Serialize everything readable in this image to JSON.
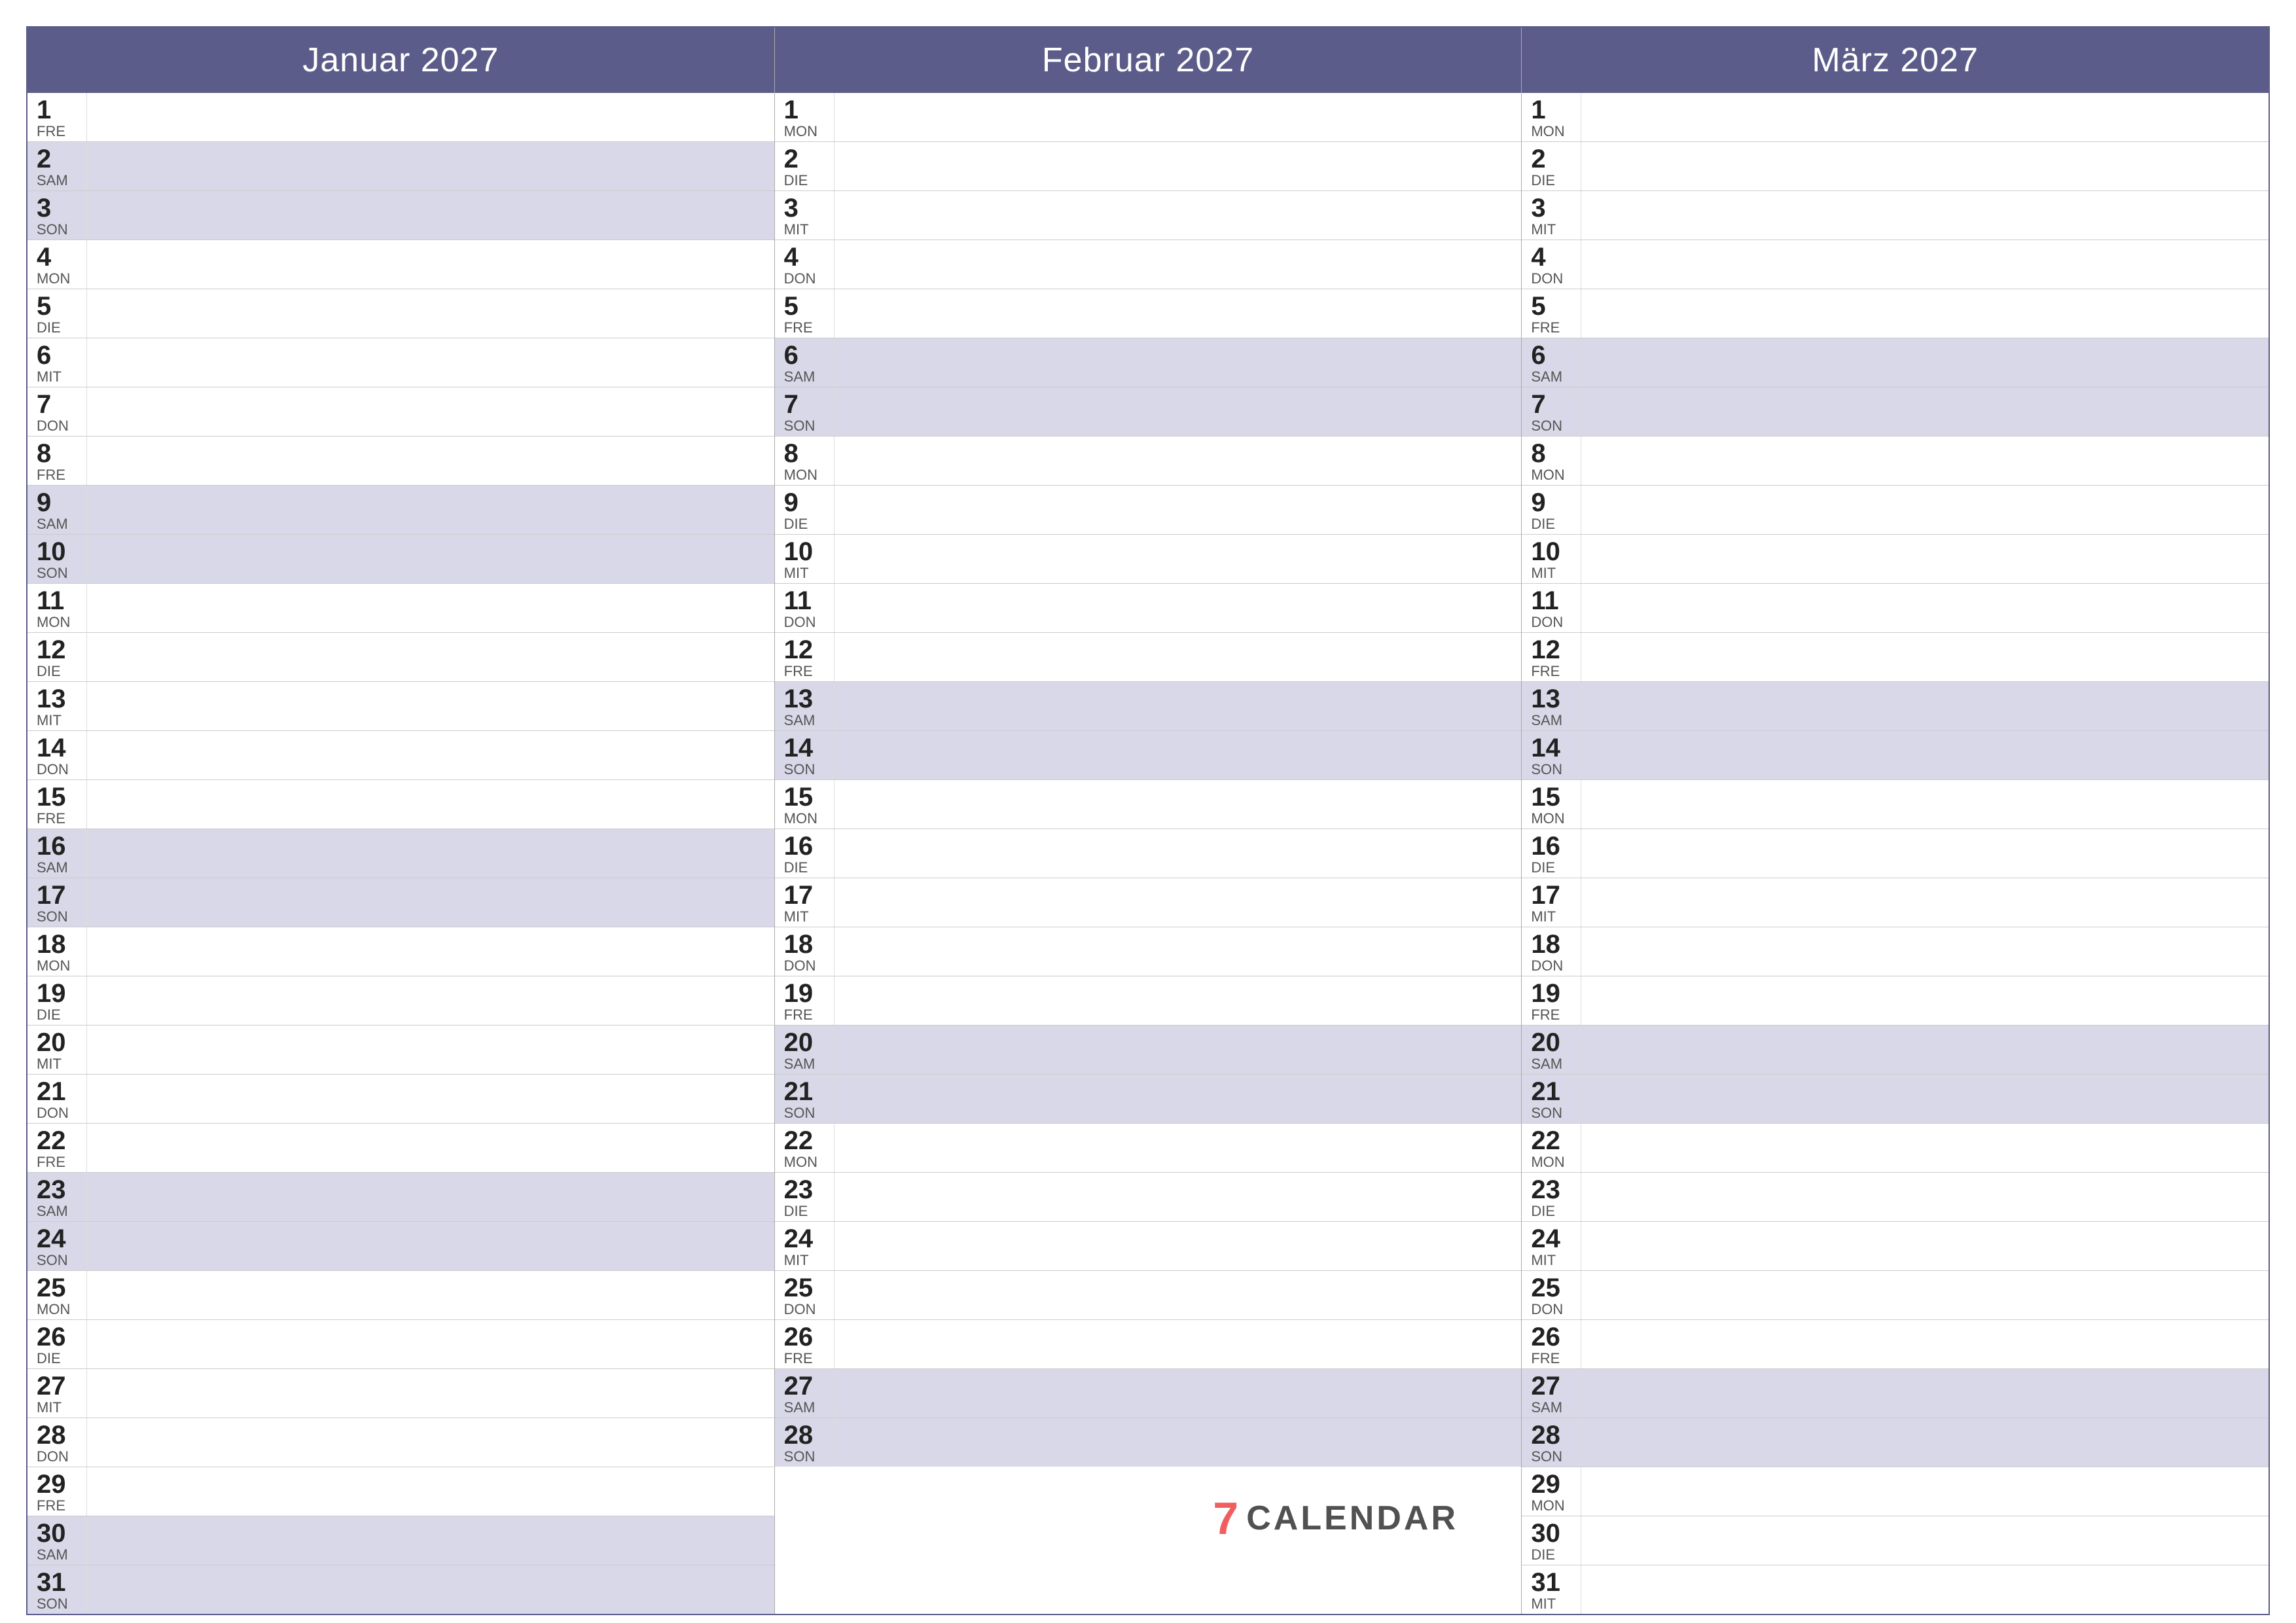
{
  "months": [
    {
      "title": "Januar 2027",
      "days": [
        {
          "num": "1",
          "abbr": "FRE",
          "weekend": false
        },
        {
          "num": "2",
          "abbr": "SAM",
          "weekend": true
        },
        {
          "num": "3",
          "abbr": "SON",
          "weekend": true
        },
        {
          "num": "4",
          "abbr": "MON",
          "weekend": false
        },
        {
          "num": "5",
          "abbr": "DIE",
          "weekend": false
        },
        {
          "num": "6",
          "abbr": "MIT",
          "weekend": false
        },
        {
          "num": "7",
          "abbr": "DON",
          "weekend": false
        },
        {
          "num": "8",
          "abbr": "FRE",
          "weekend": false
        },
        {
          "num": "9",
          "abbr": "SAM",
          "weekend": true
        },
        {
          "num": "10",
          "abbr": "SON",
          "weekend": true
        },
        {
          "num": "11",
          "abbr": "MON",
          "weekend": false
        },
        {
          "num": "12",
          "abbr": "DIE",
          "weekend": false
        },
        {
          "num": "13",
          "abbr": "MIT",
          "weekend": false
        },
        {
          "num": "14",
          "abbr": "DON",
          "weekend": false
        },
        {
          "num": "15",
          "abbr": "FRE",
          "weekend": false
        },
        {
          "num": "16",
          "abbr": "SAM",
          "weekend": true
        },
        {
          "num": "17",
          "abbr": "SON",
          "weekend": true
        },
        {
          "num": "18",
          "abbr": "MON",
          "weekend": false
        },
        {
          "num": "19",
          "abbr": "DIE",
          "weekend": false
        },
        {
          "num": "20",
          "abbr": "MIT",
          "weekend": false
        },
        {
          "num": "21",
          "abbr": "DON",
          "weekend": false
        },
        {
          "num": "22",
          "abbr": "FRE",
          "weekend": false
        },
        {
          "num": "23",
          "abbr": "SAM",
          "weekend": true
        },
        {
          "num": "24",
          "abbr": "SON",
          "weekend": true
        },
        {
          "num": "25",
          "abbr": "MON",
          "weekend": false
        },
        {
          "num": "26",
          "abbr": "DIE",
          "weekend": false
        },
        {
          "num": "27",
          "abbr": "MIT",
          "weekend": false
        },
        {
          "num": "28",
          "abbr": "DON",
          "weekend": false
        },
        {
          "num": "29",
          "abbr": "FRE",
          "weekend": false
        },
        {
          "num": "30",
          "abbr": "SAM",
          "weekend": true
        },
        {
          "num": "31",
          "abbr": "SON",
          "weekend": true
        }
      ]
    },
    {
      "title": "Februar 2027",
      "days": [
        {
          "num": "1",
          "abbr": "MON",
          "weekend": false
        },
        {
          "num": "2",
          "abbr": "DIE",
          "weekend": false
        },
        {
          "num": "3",
          "abbr": "MIT",
          "weekend": false
        },
        {
          "num": "4",
          "abbr": "DON",
          "weekend": false
        },
        {
          "num": "5",
          "abbr": "FRE",
          "weekend": false
        },
        {
          "num": "6",
          "abbr": "SAM",
          "weekend": true
        },
        {
          "num": "7",
          "abbr": "SON",
          "weekend": true
        },
        {
          "num": "8",
          "abbr": "MON",
          "weekend": false
        },
        {
          "num": "9",
          "abbr": "DIE",
          "weekend": false
        },
        {
          "num": "10",
          "abbr": "MIT",
          "weekend": false
        },
        {
          "num": "11",
          "abbr": "DON",
          "weekend": false
        },
        {
          "num": "12",
          "abbr": "FRE",
          "weekend": false
        },
        {
          "num": "13",
          "abbr": "SAM",
          "weekend": true
        },
        {
          "num": "14",
          "abbr": "SON",
          "weekend": true
        },
        {
          "num": "15",
          "abbr": "MON",
          "weekend": false
        },
        {
          "num": "16",
          "abbr": "DIE",
          "weekend": false
        },
        {
          "num": "17",
          "abbr": "MIT",
          "weekend": false
        },
        {
          "num": "18",
          "abbr": "DON",
          "weekend": false
        },
        {
          "num": "19",
          "abbr": "FRE",
          "weekend": false
        },
        {
          "num": "20",
          "abbr": "SAM",
          "weekend": true
        },
        {
          "num": "21",
          "abbr": "SON",
          "weekend": true
        },
        {
          "num": "22",
          "abbr": "MON",
          "weekend": false
        },
        {
          "num": "23",
          "abbr": "DIE",
          "weekend": false
        },
        {
          "num": "24",
          "abbr": "MIT",
          "weekend": false
        },
        {
          "num": "25",
          "abbr": "DON",
          "weekend": false
        },
        {
          "num": "26",
          "abbr": "FRE",
          "weekend": false
        },
        {
          "num": "27",
          "abbr": "SAM",
          "weekend": true
        },
        {
          "num": "28",
          "abbr": "SON",
          "weekend": true
        }
      ]
    },
    {
      "title": "März 2027",
      "days": [
        {
          "num": "1",
          "abbr": "MON",
          "weekend": false
        },
        {
          "num": "2",
          "abbr": "DIE",
          "weekend": false
        },
        {
          "num": "3",
          "abbr": "MIT",
          "weekend": false
        },
        {
          "num": "4",
          "abbr": "DON",
          "weekend": false
        },
        {
          "num": "5",
          "abbr": "FRE",
          "weekend": false
        },
        {
          "num": "6",
          "abbr": "SAM",
          "weekend": true
        },
        {
          "num": "7",
          "abbr": "SON",
          "weekend": true
        },
        {
          "num": "8",
          "abbr": "MON",
          "weekend": false
        },
        {
          "num": "9",
          "abbr": "DIE",
          "weekend": false
        },
        {
          "num": "10",
          "abbr": "MIT",
          "weekend": false
        },
        {
          "num": "11",
          "abbr": "DON",
          "weekend": false
        },
        {
          "num": "12",
          "abbr": "FRE",
          "weekend": false
        },
        {
          "num": "13",
          "abbr": "SAM",
          "weekend": true
        },
        {
          "num": "14",
          "abbr": "SON",
          "weekend": true
        },
        {
          "num": "15",
          "abbr": "MON",
          "weekend": false
        },
        {
          "num": "16",
          "abbr": "DIE",
          "weekend": false
        },
        {
          "num": "17",
          "abbr": "MIT",
          "weekend": false
        },
        {
          "num": "18",
          "abbr": "DON",
          "weekend": false
        },
        {
          "num": "19",
          "abbr": "FRE",
          "weekend": false
        },
        {
          "num": "20",
          "abbr": "SAM",
          "weekend": true
        },
        {
          "num": "21",
          "abbr": "SON",
          "weekend": true
        },
        {
          "num": "22",
          "abbr": "MON",
          "weekend": false
        },
        {
          "num": "23",
          "abbr": "DIE",
          "weekend": false
        },
        {
          "num": "24",
          "abbr": "MIT",
          "weekend": false
        },
        {
          "num": "25",
          "abbr": "DON",
          "weekend": false
        },
        {
          "num": "26",
          "abbr": "FRE",
          "weekend": false
        },
        {
          "num": "27",
          "abbr": "SAM",
          "weekend": true
        },
        {
          "num": "28",
          "abbr": "SON",
          "weekend": true
        },
        {
          "num": "29",
          "abbr": "MON",
          "weekend": false
        },
        {
          "num": "30",
          "abbr": "DIE",
          "weekend": false
        },
        {
          "num": "31",
          "abbr": "MIT",
          "weekend": false
        }
      ]
    }
  ],
  "brand": {
    "icon": "7",
    "text": "CALENDAR"
  }
}
